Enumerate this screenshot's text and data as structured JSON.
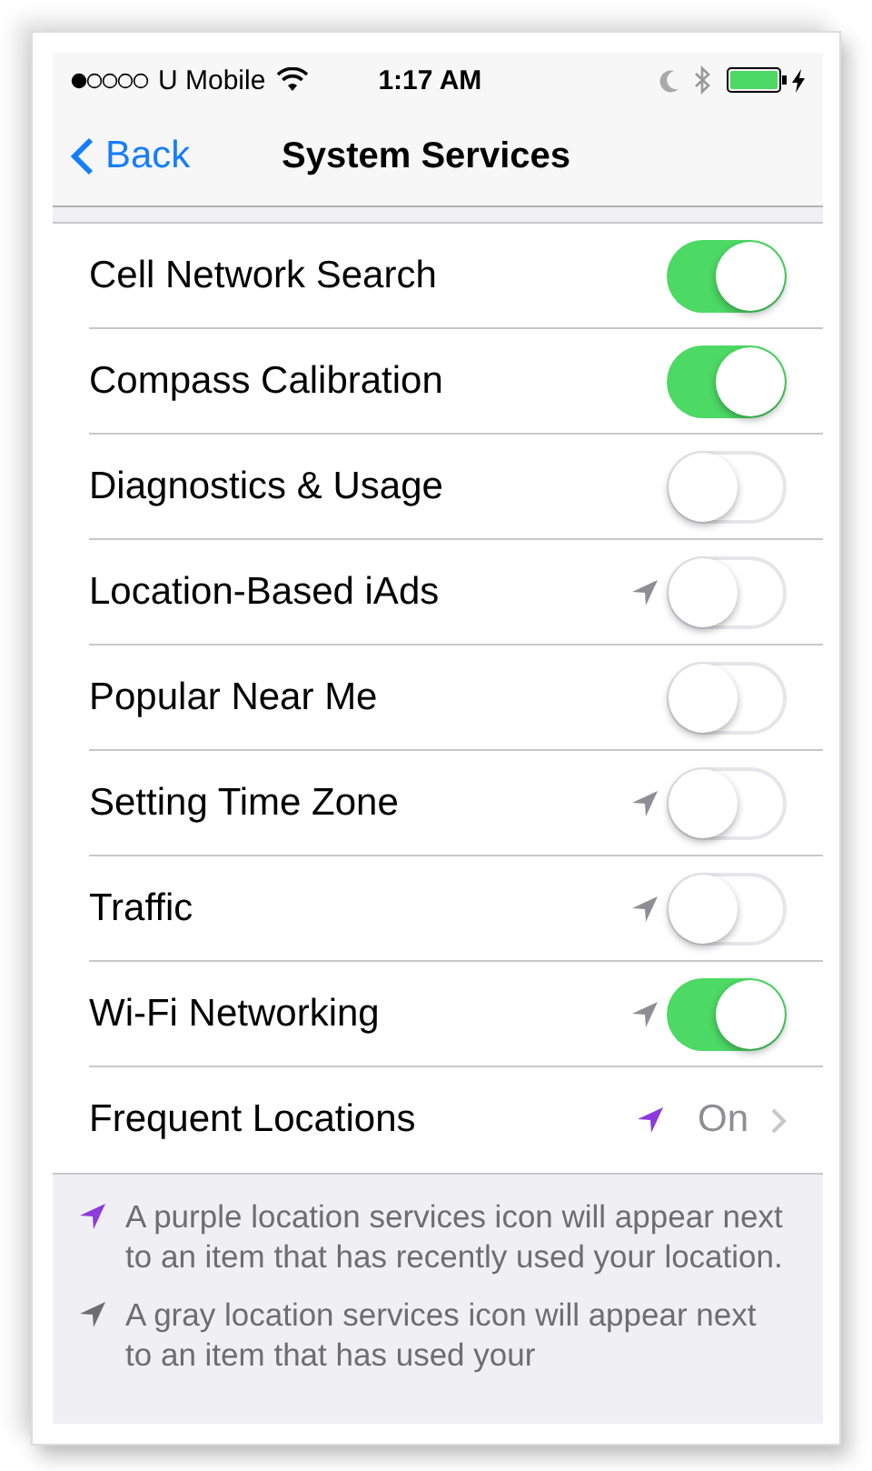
{
  "status_bar": {
    "carrier": "U Mobile",
    "time": "1:17 AM"
  },
  "nav_bar": {
    "back": "Back",
    "title": "System Services"
  },
  "rows": [
    {
      "kind": "toggle",
      "label": "Cell Network Search",
      "on": true
    },
    {
      "kind": "toggle",
      "label": "Compass Calibration",
      "on": true
    },
    {
      "kind": "toggle",
      "label": "Diagnostics & Usage",
      "on": false
    },
    {
      "kind": "toggle",
      "label": "Location-Based iAds",
      "on": false,
      "color": "#8e8e93"
    },
    {
      "kind": "toggle",
      "label": "Popular Near Me",
      "on": false
    },
    {
      "kind": "toggle",
      "label": "Setting Time Zone",
      "on": false,
      "color": "#8e8e93"
    },
    {
      "kind": "toggle",
      "label": "Traffic",
      "on": false,
      "color": "#8e8e93"
    },
    {
      "kind": "toggle",
      "label": "Wi-Fi Networking",
      "on": true,
      "color": "#8e8e93"
    },
    {
      "kind": "detail",
      "label": "Frequent Locations",
      "value": "On",
      "color": "#8c3bdb"
    }
  ],
  "notes": [
    {
      "color": "#8c3bdb",
      "text": "A purple location services icon will appear next to an item that has recently used your location."
    },
    {
      "color": "#6d6d72",
      "text": "A gray location services icon will appear next to an item that has used your"
    }
  ]
}
